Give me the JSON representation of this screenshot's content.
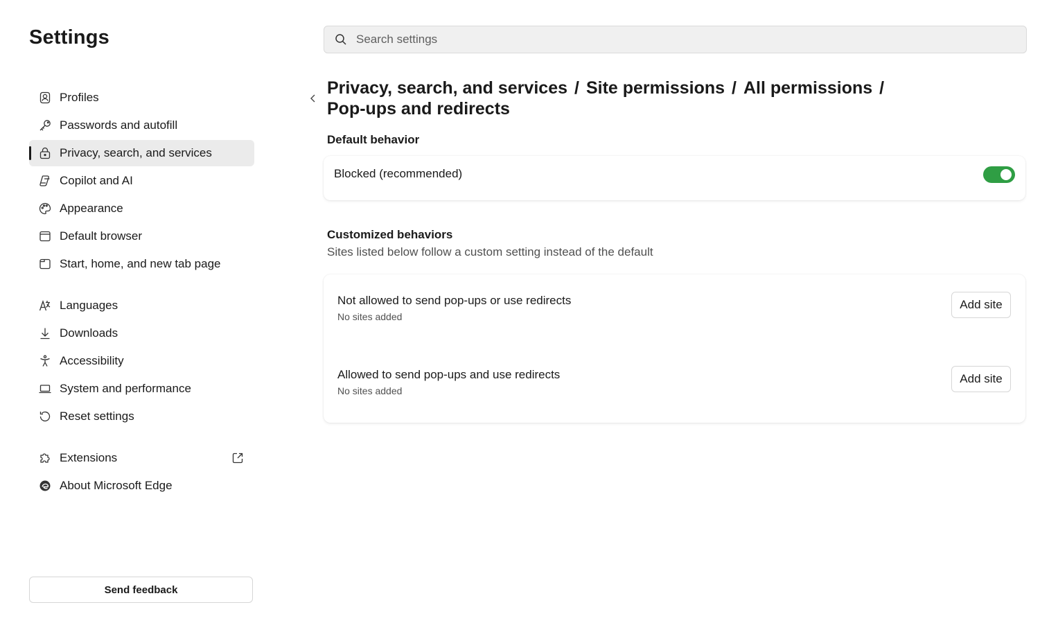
{
  "sidebar": {
    "title": "Settings",
    "items": [
      {
        "label": "Profiles"
      },
      {
        "label": "Passwords and autofill"
      },
      {
        "label": "Privacy, search, and services"
      },
      {
        "label": "Copilot and AI"
      },
      {
        "label": "Appearance"
      },
      {
        "label": "Default browser"
      },
      {
        "label": "Start, home, and new tab page"
      },
      {
        "label": "Languages"
      },
      {
        "label": "Downloads"
      },
      {
        "label": "Accessibility"
      },
      {
        "label": "System and performance"
      },
      {
        "label": "Reset settings"
      },
      {
        "label": "Extensions"
      },
      {
        "label": "About Microsoft Edge"
      }
    ],
    "active_item": "Privacy, search, and services",
    "feedback_label": "Send feedback"
  },
  "search": {
    "placeholder": "Search settings"
  },
  "breadcrumb": {
    "parts": [
      "Privacy, search, and services",
      "Site permissions",
      "All permissions",
      "Pop-ups and redirects"
    ],
    "separator": "/"
  },
  "default_behavior": {
    "title": "Default behavior",
    "label": "Blocked (recommended)",
    "enabled": true
  },
  "customized": {
    "title": "Customized behaviors",
    "subtitle": "Sites listed below follow a custom setting instead of the default",
    "rows": [
      {
        "title": "Not allowed to send pop-ups or use redirects",
        "status": "No sites added",
        "button": "Add site"
      },
      {
        "title": "Allowed to send pop-ups and use redirects",
        "status": "No sites added",
        "button": "Add site"
      }
    ]
  },
  "colors": {
    "accent": "#2f9e44",
    "active_nav_bg": "#ebebeb"
  }
}
